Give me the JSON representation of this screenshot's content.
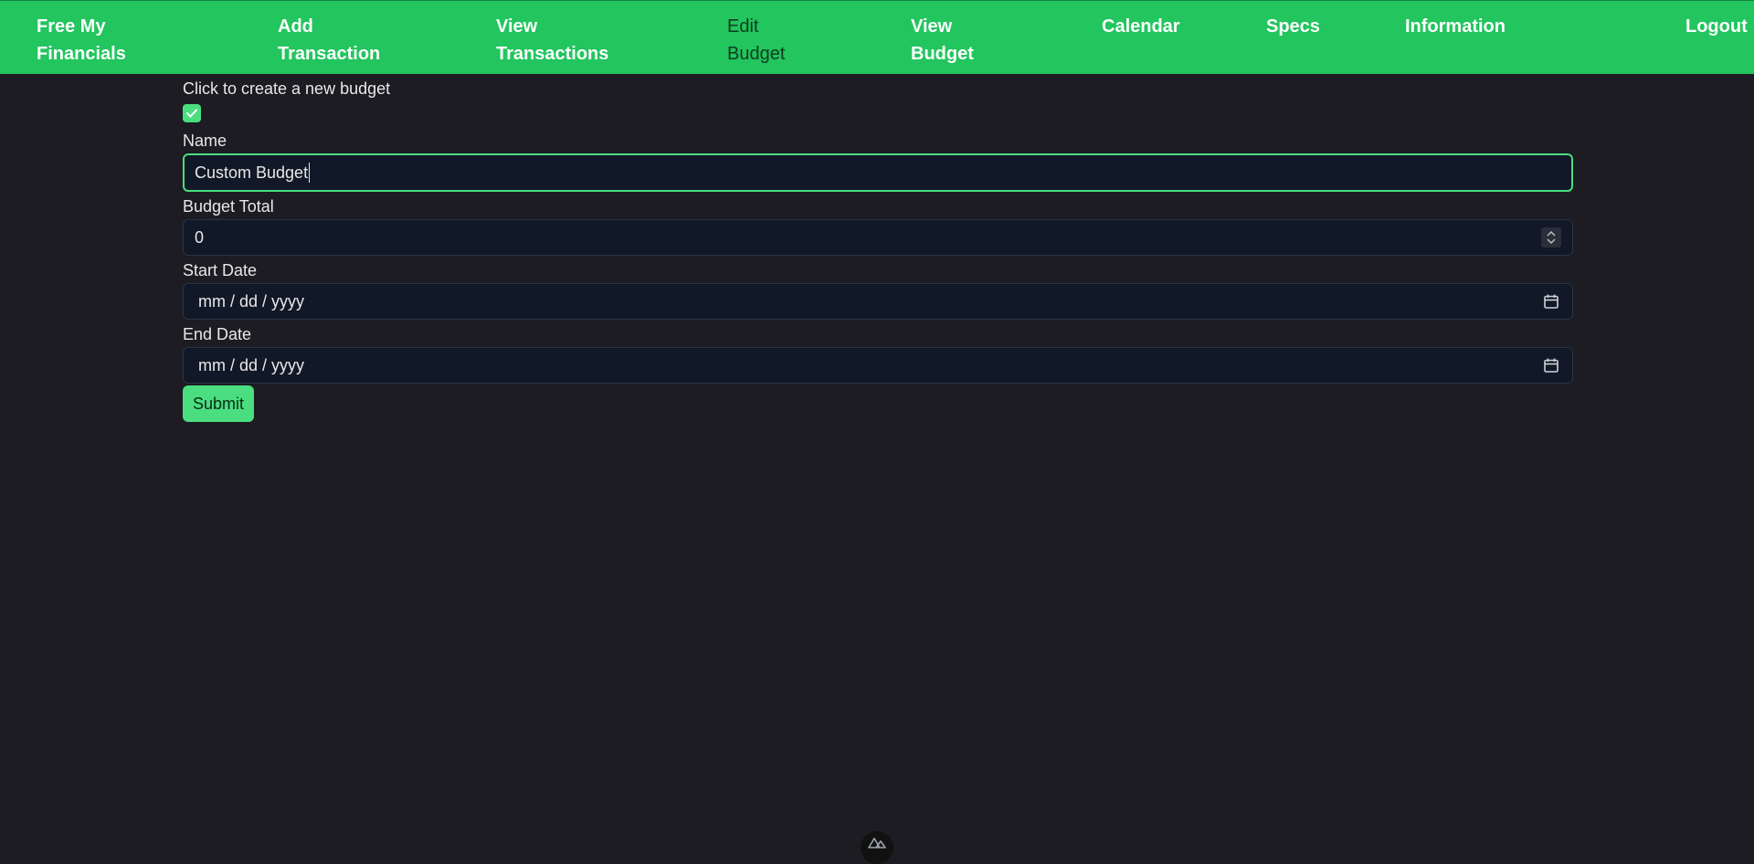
{
  "nav": {
    "brand": "Free My Financials",
    "items": [
      {
        "label": "Add Transaction"
      },
      {
        "label": "View Transactions"
      },
      {
        "label": "Edit Budget"
      },
      {
        "label": "View Budget"
      },
      {
        "label": "Calendar"
      },
      {
        "label": "Specs"
      },
      {
        "label": "Information"
      }
    ],
    "logout": "Logout",
    "active": "Edit Budget"
  },
  "form": {
    "create_label": "Click to create a new budget",
    "create_checked": true,
    "name_label": "Name",
    "name_value": "Custom Budget",
    "total_label": "Budget Total",
    "total_value": "0",
    "start_label": "Start Date",
    "start_placeholder": "mm / dd / yyyy",
    "end_label": "End Date",
    "end_placeholder": "mm / dd / yyyy",
    "submit_label": "Submit"
  },
  "colors": {
    "accent": "#22c55e",
    "accent_light": "#4ade80",
    "background": "#1c1c22",
    "field_bg": "#111827"
  }
}
